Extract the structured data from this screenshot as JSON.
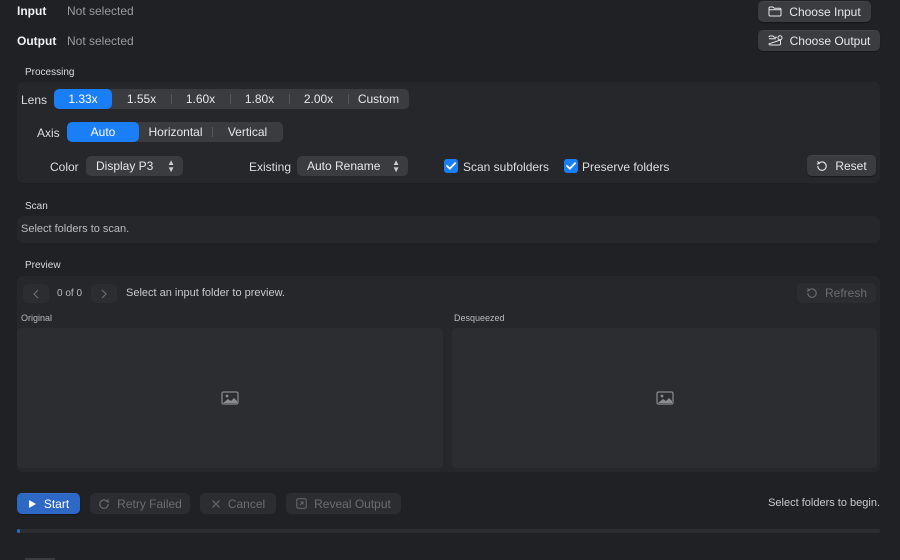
{
  "input": {
    "label": "Input",
    "value": "Not selected",
    "button": "Choose Input"
  },
  "output": {
    "label": "Output",
    "value": "Not selected",
    "button": "Choose Output"
  },
  "processing": {
    "title": "Processing",
    "lens_label": "Lens",
    "lens_options": [
      "1.33x",
      "1.55x",
      "1.60x",
      "1.80x",
      "2.00x",
      "Custom"
    ],
    "lens_selected": "1.33x",
    "axis_label": "Axis",
    "axis_options": [
      "Auto",
      "Horizontal",
      "Vertical"
    ],
    "axis_selected": "Auto",
    "color_label": "Color",
    "color_value": "Display P3",
    "existing_label": "Existing",
    "existing_value": "Auto Rename",
    "scan_subfolders_label": "Scan subfolders",
    "scan_subfolders_checked": true,
    "preserve_folders_label": "Preserve folders",
    "preserve_folders_checked": true,
    "reset_label": "Reset"
  },
  "scan": {
    "title": "Scan",
    "message": "Select folders to scan."
  },
  "preview": {
    "title": "Preview",
    "counter": "0 of 0",
    "message": "Select an input folder to preview.",
    "refresh_label": "Refresh",
    "original_label": "Original",
    "desqueezed_label": "Desqueezed"
  },
  "actions": {
    "start": "Start",
    "retry": "Retry Failed",
    "cancel": "Cancel",
    "reveal": "Reveal Output",
    "status": "Select folders to begin."
  },
  "colors": {
    "accent": "#1a7ef7",
    "background": "#1f2124"
  }
}
